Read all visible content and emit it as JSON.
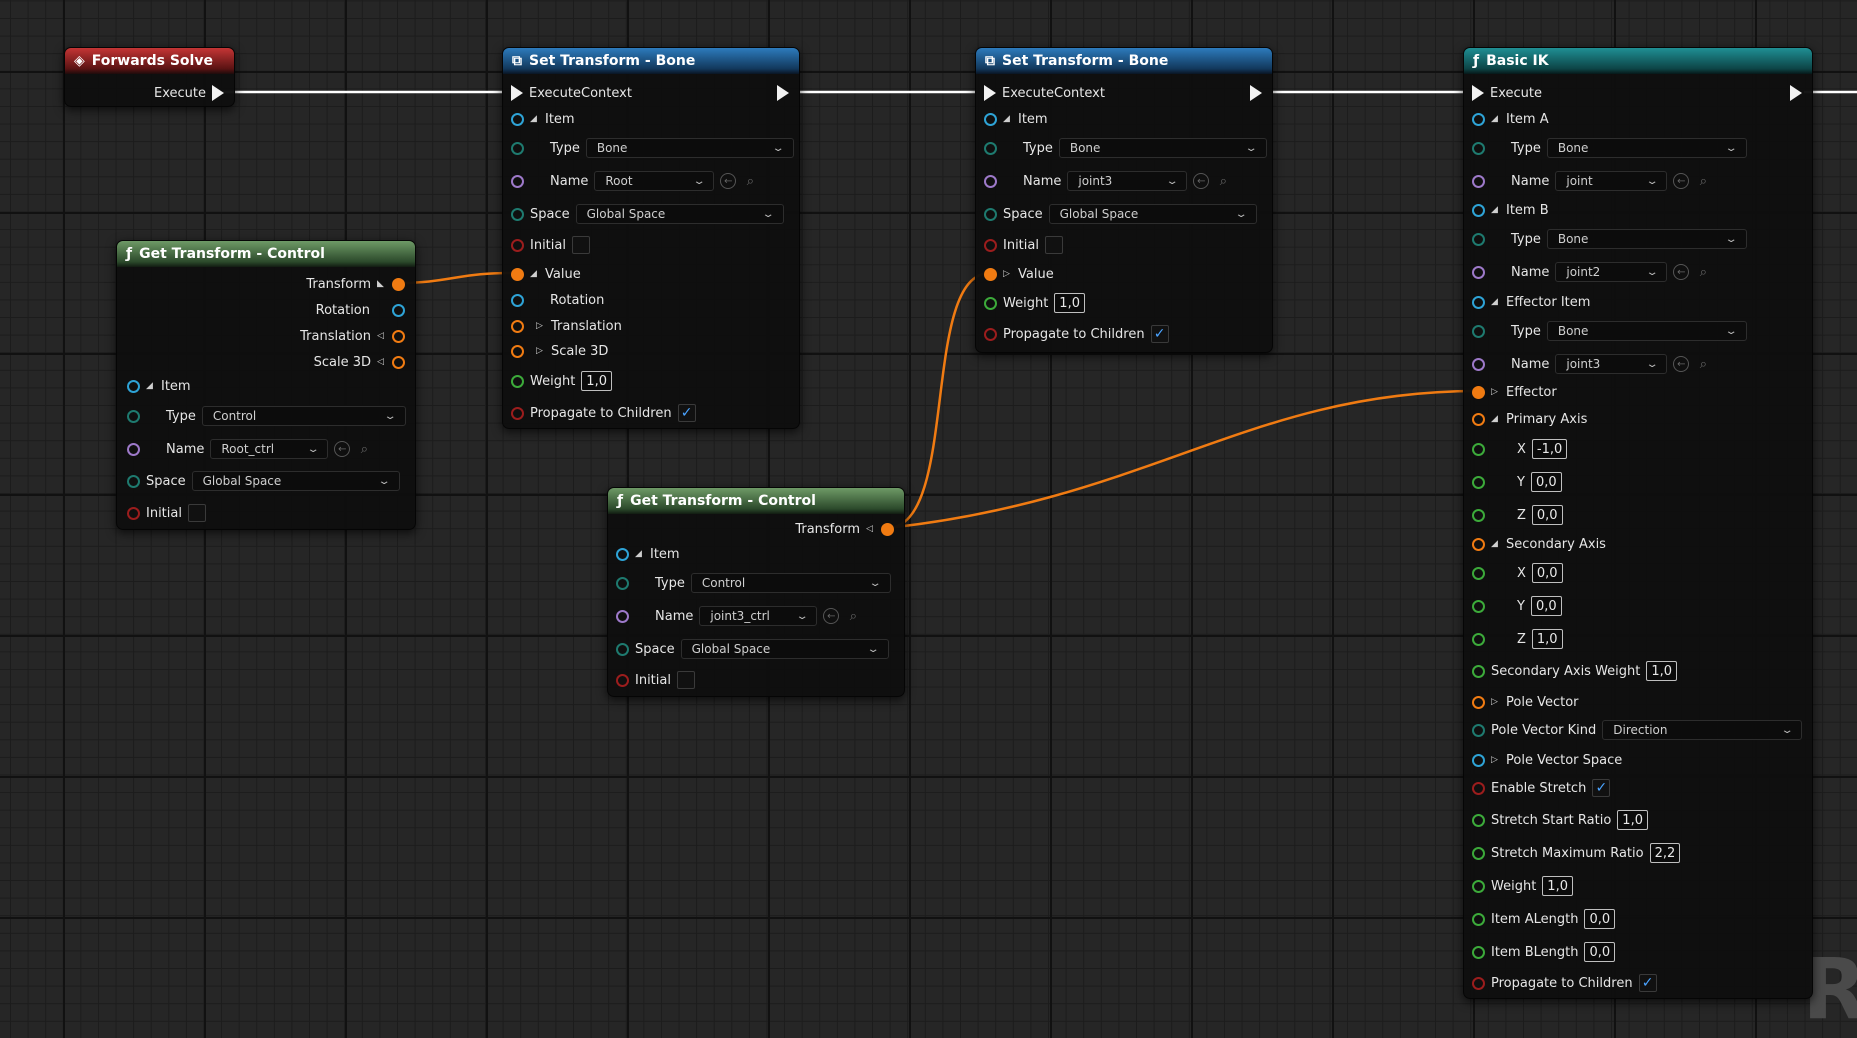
{
  "forwards_solve": {
    "title": "Forwards Solve",
    "execute": "Execute"
  },
  "get_transform_root": {
    "title": "Get Transform - Control",
    "transform": "Transform",
    "rotation": "Rotation",
    "translation": "Translation",
    "scale": "Scale 3D",
    "item": "Item",
    "type_label": "Type",
    "type_value": "Control",
    "name_label": "Name",
    "name_value": "Root_ctrl",
    "space_label": "Space",
    "space_value": "Global Space",
    "initial_label": "Initial"
  },
  "set_transform_1": {
    "title": "Set Transform - Bone",
    "execute": "ExecuteContext",
    "item": "Item",
    "type_label": "Type",
    "type_value": "Bone",
    "name_label": "Name",
    "name_value": "Root",
    "space_label": "Space",
    "space_value": "Global Space",
    "initial_label": "Initial",
    "value_label": "Value",
    "rotation": "Rotation",
    "translation": "Translation",
    "scale": "Scale 3D",
    "weight_label": "Weight",
    "weight_value": "1,0",
    "propagate_label": "Propagate to Children"
  },
  "get_transform_joint3": {
    "title": "Get Transform - Control",
    "transform": "Transform",
    "item": "Item",
    "type_label": "Type",
    "type_value": "Control",
    "name_label": "Name",
    "name_value": "joint3_ctrl",
    "space_label": "Space",
    "space_value": "Global Space",
    "initial_label": "Initial"
  },
  "set_transform_2": {
    "title": "Set Transform - Bone",
    "execute": "ExecuteContext",
    "item": "Item",
    "type_label": "Type",
    "type_value": "Bone",
    "name_label": "Name",
    "name_value": "joint3",
    "space_label": "Space",
    "space_value": "Global Space",
    "initial_label": "Initial",
    "value_label": "Value",
    "weight_label": "Weight",
    "weight_value": "1,0",
    "propagate_label": "Propagate to Children"
  },
  "basic_ik": {
    "title": "Basic IK",
    "execute": "Execute",
    "item_a": "Item A",
    "item_b": "Item B",
    "effector_item": "Effector Item",
    "type_label": "Type",
    "name_label": "Name",
    "a_type": "Bone",
    "a_name": "joint",
    "b_type": "Bone",
    "b_name": "joint2",
    "e_type": "Bone",
    "e_name": "joint3",
    "effector": "Effector",
    "primary_axis": "Primary Axis",
    "px": "-1,0",
    "py": "0,0",
    "pz": "0,0",
    "secondary_axis": "Secondary Axis",
    "sx": "0,0",
    "sy": "0,0",
    "sz": "1,0",
    "x": "X",
    "y": "Y",
    "z": "Z",
    "secondary_weight_label": "Secondary Axis Weight",
    "secondary_weight": "1,0",
    "pole_vector": "Pole Vector",
    "pole_kind_label": "Pole Vector Kind",
    "pole_kind": "Direction",
    "pole_space": "Pole Vector Space",
    "enable_stretch": "Enable Stretch",
    "stretch_start_label": "Stretch Start Ratio",
    "stretch_start": "1,0",
    "stretch_max_label": "Stretch Maximum Ratio",
    "stretch_max": "2,2",
    "weight_label": "Weight",
    "weight": "1,0",
    "alength_label": "Item ALength",
    "alength": "0,0",
    "blength_label": "Item BLength",
    "blength": "0,0",
    "propagate_label": "Propagate to Children"
  },
  "watermark": "R",
  "colors": {
    "wire_exec": "#ffffff",
    "wire_transform": "#f07b12",
    "checkbox": "#4aa3ff"
  }
}
